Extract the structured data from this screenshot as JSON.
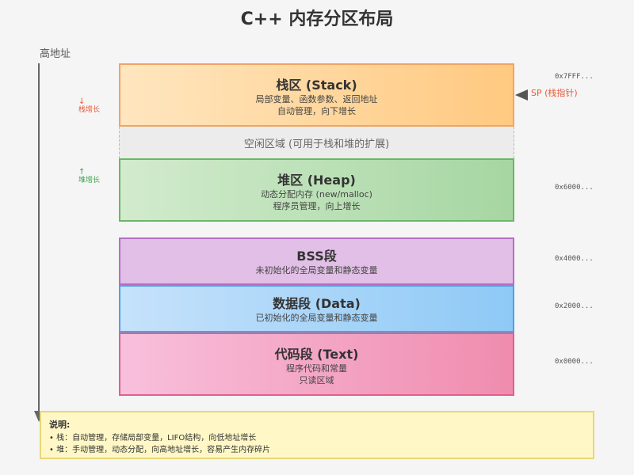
{
  "title": "C++ 内存分区布局",
  "high_address_label": "高地址",
  "growth": {
    "stack_arrow": "↓",
    "stack_label": "栈增长",
    "heap_arrow": "↑",
    "heap_label": "堆增长"
  },
  "segments": {
    "stack": {
      "name": "栈区 (Stack)",
      "desc": [
        "局部变量、函数参数、返回地址",
        "自动管理，向下增长"
      ],
      "color": "#ffc980"
    },
    "free": {
      "text": "空闲区域 (可用于栈和堆的扩展)"
    },
    "heap": {
      "name": "堆区 (Heap)",
      "desc": [
        "动态分配内存 (new/malloc)",
        "程序员管理，向上增长"
      ],
      "color": "#a6d6a2"
    },
    "bss": {
      "name": "BSS段",
      "desc": [
        "未初始化的全局变量和静态变量"
      ],
      "color": "#e1bfe6"
    },
    "data": {
      "name": "数据段 (Data)",
      "desc": [
        "已初始化的全局变量和静态变量"
      ],
      "color": "#8ec9f6"
    },
    "text": {
      "name": "代码段 (Text)",
      "desc": [
        "程序代码和常量",
        "只读区域"
      ],
      "color": "#f08cae"
    }
  },
  "addresses": {
    "stack": "0x7FFF...",
    "heap": "0x6000...",
    "bss": "0x4000...",
    "data": "0x2000...",
    "text": "0x0000..."
  },
  "sp_label": "SP (栈指针)",
  "legend": {
    "title": "说明:",
    "items": [
      "• 栈：自动管理，存储局部变量，LIFO结构，向低地址增长",
      "• 堆：手动管理，动态分配，向高地址增长，容易产生内存碎片"
    ]
  }
}
